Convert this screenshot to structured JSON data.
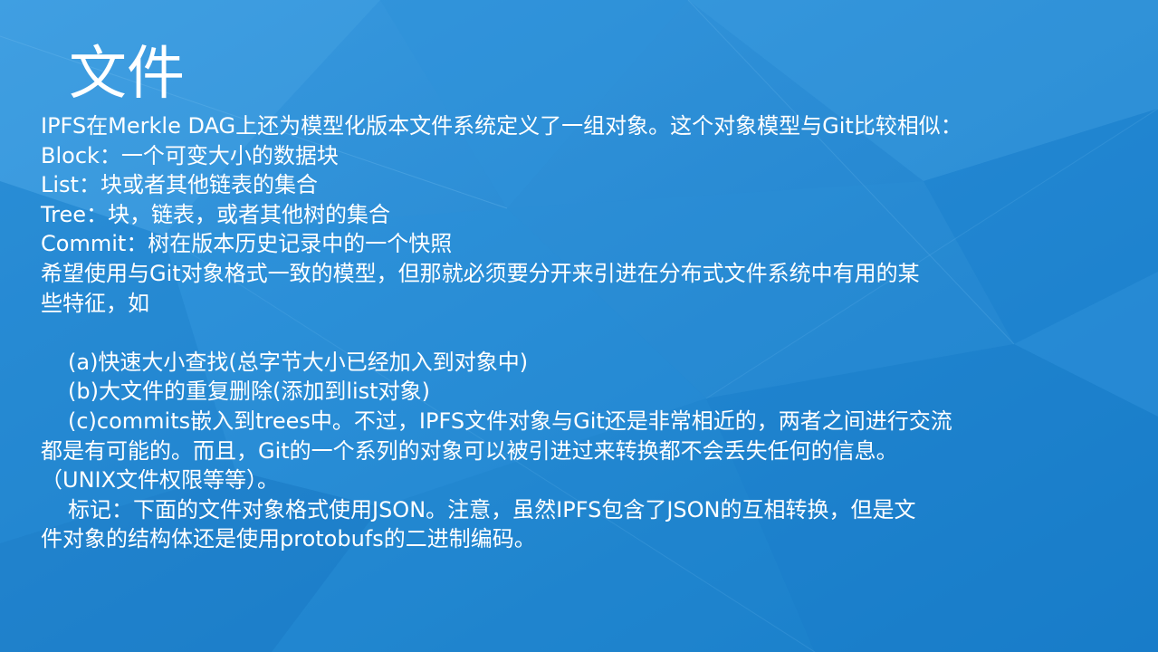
{
  "slide": {
    "title": "文件",
    "lines": [
      "IPFS在Merkle DAG上还为模型化版本文件系统定义了一组对象。这个对象模型与Git比较相似：",
      "Block：一个可变大小的数据块",
      "List：块或者其他链表的集合",
      "Tree：块，链表，或者其他树的集合",
      "Commit：树在版本历史记录中的一个快照",
      "希望使用与Git对象格式一致的模型，但那就必须要分开来引进在分布式文件系统中有用的某",
      "些特征，如",
      "(a)快速大小查找(总字节大小已经加入到对象中)",
      "(b)大文件的重复删除(添加到list对象)",
      "(c)commits嵌入到trees中。不过，IPFS文件对象与Git还是非常相近的，两者之间进行交流",
      "都是有可能的。而且，Git的一个系列的对象可以被引进过来转换都不会丢失任何的信息。",
      "（UNIX文件权限等等）。",
      "标记：下面的文件对象格式使用JSON。注意，虽然IPFS包含了JSON的互相转换，但是文",
      "件对象的结构体还是使用protobufs的二进制编码。"
    ]
  },
  "colors": {
    "background": "#1f8ad4",
    "text": "#ffffff"
  }
}
